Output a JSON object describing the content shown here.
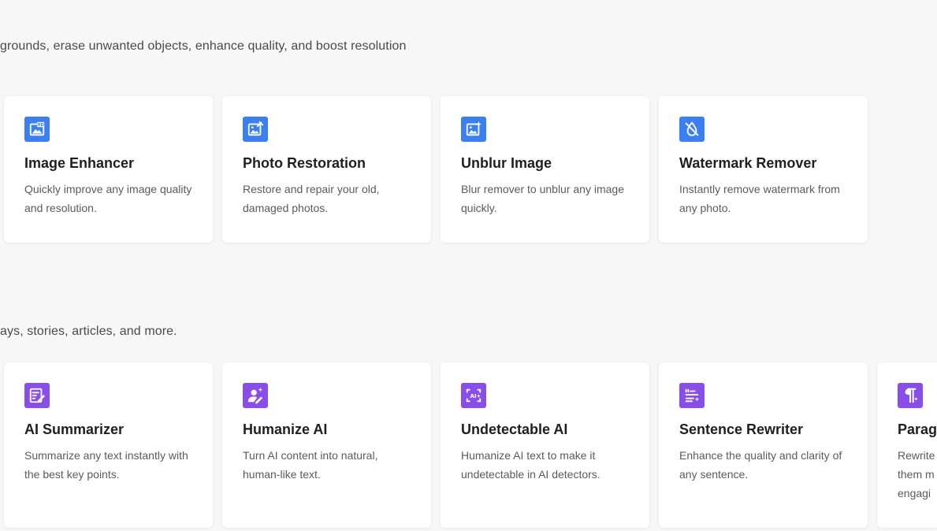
{
  "sections": [
    {
      "description": "grounds, erase unwanted objects, enhance quality, and boost resolution",
      "cards": [
        {
          "title": "Image Enhancer",
          "description": "Quickly improve any image quality and resolution.",
          "icon": "hd-image-icon"
        },
        {
          "title": "Photo Restoration",
          "description": "Restore and repair your old, damaged photos.",
          "icon": "photo-repair-icon"
        },
        {
          "title": "Unblur Image",
          "description": "Blur remover to unblur any image quickly.",
          "icon": "sparkle-image-icon"
        },
        {
          "title": "Watermark Remover",
          "description": "Instantly remove watermark from any photo.",
          "icon": "no-watermark-icon"
        }
      ]
    },
    {
      "description": "ays, stories, articles, and more.",
      "cards": [
        {
          "title": "AI Summarizer",
          "description": "Summarize any text instantly with the best key points.",
          "icon": "document-pen-icon"
        },
        {
          "title": "Humanize AI",
          "description": "Turn AI content into natural, human-like text.",
          "icon": "user-sparkle-icon"
        },
        {
          "title": "Undetectable AI",
          "description": "Humanize AI text to make it undetectable in AI detectors.",
          "icon": "ai-frame-icon"
        },
        {
          "title": "Sentence Rewriter",
          "description": "Enhance the quality and clarity of any sentence.",
          "icon": "text-lines-sparkle-icon"
        },
        {
          "title": "Parag",
          "description": "Rewrite them m engagi",
          "icon": "paragraph-icon"
        }
      ]
    }
  ],
  "colors": {
    "blue_icon": "#3b7ff0",
    "purple_icon": "#8a4ee8",
    "background": "#f7f7f7"
  }
}
